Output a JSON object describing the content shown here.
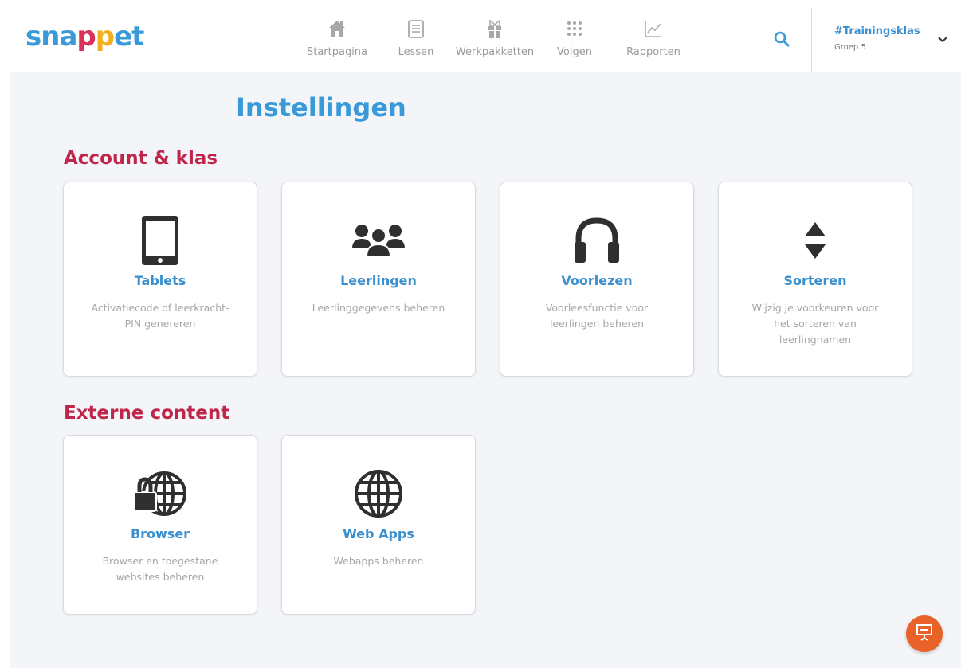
{
  "header": {
    "logo_letters": [
      "s",
      "n",
      "a",
      "p",
      "p",
      "e",
      "t"
    ],
    "logo_colors": [
      "#3a9ad9",
      "#3a9ad9",
      "#3a9ad9",
      "#d9315a",
      "#f2b01e",
      "#3a9ad9",
      "#3a9ad9"
    ],
    "nav": [
      {
        "label": "Startpagina",
        "icon": "home-icon"
      },
      {
        "label": "Lessen",
        "icon": "lessons-icon"
      },
      {
        "label": "Werkpakketten",
        "icon": "gift-icon"
      },
      {
        "label": "Volgen",
        "icon": "grid-dots-icon"
      },
      {
        "label": "Rapporten",
        "icon": "chart-icon"
      }
    ],
    "search_icon": "search-icon",
    "class_name": "#Trainingsklas",
    "class_group": "Groep 5",
    "accent_color": "#3a9ad9"
  },
  "page": {
    "title": "Instellingen"
  },
  "sections": [
    {
      "title": "Account & klas",
      "cards": [
        {
          "title": "Tablets",
          "description": "Activatiecode of leerkracht-PIN genereren",
          "icon": "tablet-icon"
        },
        {
          "title": "Leerlingen",
          "description": "Leerlinggegevens beheren",
          "icon": "users-icon"
        },
        {
          "title": "Voorlezen",
          "description": "Voorleesfunctie voor leerlingen beheren",
          "icon": "headphones-icon"
        },
        {
          "title": "Sorteren",
          "description": "Wijzig je voorkeuren voor het sorteren van leerlingnamen",
          "icon": "sort-icon"
        }
      ]
    },
    {
      "title": "Externe content",
      "cards": [
        {
          "title": "Browser",
          "description": "Browser en toegestane websites beheren",
          "icon": "lock-globe-icon"
        },
        {
          "title": "Web Apps",
          "description": "Webapps beheren",
          "icon": "globe-icon"
        }
      ]
    }
  ],
  "colors": {
    "section_title": "#c0264a",
    "card_title": "#3a8fcf",
    "fab": "#e8622a"
  },
  "fab_icon": "presentation-icon"
}
